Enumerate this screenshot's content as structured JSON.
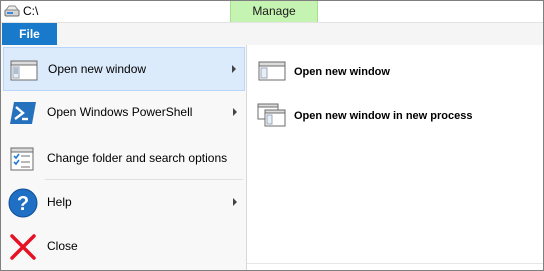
{
  "window": {
    "title": "C:\\",
    "contextual_tab": "Manage"
  },
  "ribbon": {
    "file_tab": "File"
  },
  "file_menu": {
    "items": [
      {
        "label": "Open new window",
        "has_submenu": true,
        "selected": true,
        "icon": "window-icon"
      },
      {
        "label": "Open Windows PowerShell",
        "has_submenu": true,
        "selected": false,
        "icon": "powershell-icon"
      },
      {
        "label": "Change folder and search options",
        "has_submenu": false,
        "selected": false,
        "icon": "folder-options-icon"
      },
      {
        "label": "Help",
        "has_submenu": true,
        "selected": false,
        "icon": "help-icon"
      },
      {
        "label": "Close",
        "has_submenu": false,
        "selected": false,
        "icon": "close-icon"
      }
    ]
  },
  "submenu": {
    "items": [
      {
        "label": "Open new window",
        "icon": "window-icon"
      },
      {
        "label": "Open new window in new process",
        "icon": "windows-stack-icon"
      }
    ]
  },
  "colors": {
    "file_tab": "#1979ca",
    "context_tab": "#c5f3b2",
    "selected_item": "#dcebfc"
  }
}
